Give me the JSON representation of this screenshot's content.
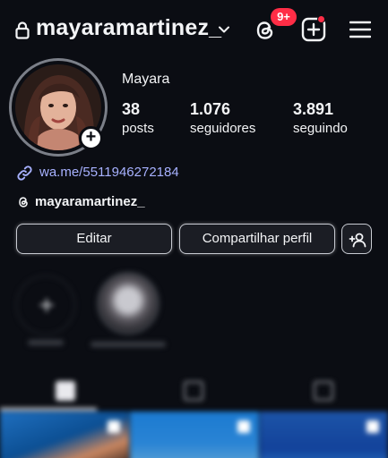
{
  "header": {
    "username": "mayaramartinez_",
    "notification_badge": "9+"
  },
  "profile": {
    "display_name": "Mayara",
    "stats": [
      {
        "value": "38",
        "label": "posts"
      },
      {
        "value": "1.076",
        "label": "seguidores"
      },
      {
        "value": "3.891",
        "label": "seguindo"
      }
    ],
    "link": "wa.me/5511946272184",
    "threads_handle": "mayaramartinez_"
  },
  "actions": {
    "edit_label": "Editar",
    "share_label": "Compartilhar perfil"
  },
  "colors": {
    "background": "#0b0d13",
    "accent_red": "#ff2d46",
    "link": "#a7b1ff"
  },
  "icons": [
    "lock-icon",
    "chevron-down-icon",
    "threads-icon",
    "add-post-icon",
    "menu-icon",
    "link-icon",
    "add-user-icon",
    "grid-icon",
    "reels-icon",
    "tagged-icon"
  ]
}
